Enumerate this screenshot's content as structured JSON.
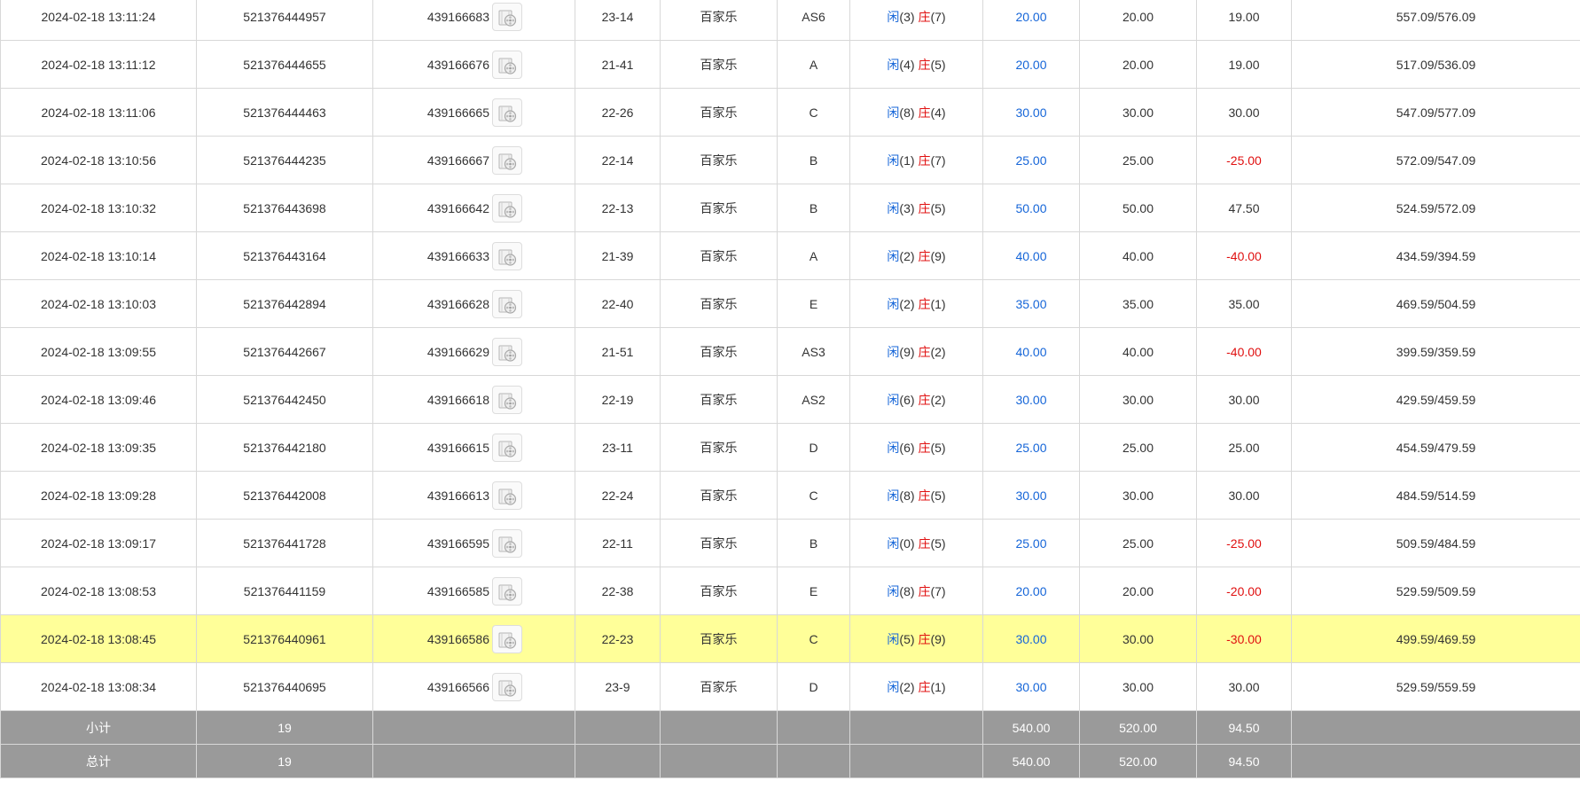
{
  "rows": [
    {
      "time": "2024-02-18 13:11:24",
      "bet_id": "521376444957",
      "round_id": "439166683",
      "table_no": "23-14",
      "game": "百家乐",
      "tbl": "AS6",
      "player_label": "闲",
      "player_pts": "(3)",
      "banker_label": "庄",
      "banker_pts": "(7)",
      "bet": "20.00",
      "valid": "20.00",
      "win": "19.00",
      "balance": "557.09/576.09"
    },
    {
      "time": "2024-02-18 13:11:12",
      "bet_id": "521376444655",
      "round_id": "439166676",
      "table_no": "21-41",
      "game": "百家乐",
      "tbl": "A",
      "player_label": "闲",
      "player_pts": "(4)",
      "banker_label": "庄",
      "banker_pts": "(5)",
      "bet": "20.00",
      "valid": "20.00",
      "win": "19.00",
      "balance": "517.09/536.09"
    },
    {
      "time": "2024-02-18 13:11:06",
      "bet_id": "521376444463",
      "round_id": "439166665",
      "table_no": "22-26",
      "game": "百家乐",
      "tbl": "C",
      "player_label": "闲",
      "player_pts": "(8)",
      "banker_label": "庄",
      "banker_pts": "(4)",
      "bet": "30.00",
      "valid": "30.00",
      "win": "30.00",
      "balance": "547.09/577.09"
    },
    {
      "time": "2024-02-18 13:10:56",
      "bet_id": "521376444235",
      "round_id": "439166667",
      "table_no": "22-14",
      "game": "百家乐",
      "tbl": "B",
      "player_label": "闲",
      "player_pts": "(1)",
      "banker_label": "庄",
      "banker_pts": "(7)",
      "bet": "25.00",
      "valid": "25.00",
      "win": "-25.00",
      "balance": "572.09/547.09"
    },
    {
      "time": "2024-02-18 13:10:32",
      "bet_id": "521376443698",
      "round_id": "439166642",
      "table_no": "22-13",
      "game": "百家乐",
      "tbl": "B",
      "player_label": "闲",
      "player_pts": "(3)",
      "banker_label": "庄",
      "banker_pts": "(5)",
      "bet": "50.00",
      "valid": "50.00",
      "win": "47.50",
      "balance": "524.59/572.09"
    },
    {
      "time": "2024-02-18 13:10:14",
      "bet_id": "521376443164",
      "round_id": "439166633",
      "table_no": "21-39",
      "game": "百家乐",
      "tbl": "A",
      "player_label": "闲",
      "player_pts": "(2)",
      "banker_label": "庄",
      "banker_pts": "(9)",
      "bet": "40.00",
      "valid": "40.00",
      "win": "-40.00",
      "balance": "434.59/394.59"
    },
    {
      "time": "2024-02-18 13:10:03",
      "bet_id": "521376442894",
      "round_id": "439166628",
      "table_no": "22-40",
      "game": "百家乐",
      "tbl": "E",
      "player_label": "闲",
      "player_pts": "(2)",
      "banker_label": "庄",
      "banker_pts": "(1)",
      "bet": "35.00",
      "valid": "35.00",
      "win": "35.00",
      "balance": "469.59/504.59"
    },
    {
      "time": "2024-02-18 13:09:55",
      "bet_id": "521376442667",
      "round_id": "439166629",
      "table_no": "21-51",
      "game": "百家乐",
      "tbl": "AS3",
      "player_label": "闲",
      "player_pts": "(9)",
      "banker_label": "庄",
      "banker_pts": "(2)",
      "bet": "40.00",
      "valid": "40.00",
      "win": "-40.00",
      "balance": "399.59/359.59"
    },
    {
      "time": "2024-02-18 13:09:46",
      "bet_id": "521376442450",
      "round_id": "439166618",
      "table_no": "22-19",
      "game": "百家乐",
      "tbl": "AS2",
      "player_label": "闲",
      "player_pts": "(6)",
      "banker_label": "庄",
      "banker_pts": "(2)",
      "bet": "30.00",
      "valid": "30.00",
      "win": "30.00",
      "balance": "429.59/459.59"
    },
    {
      "time": "2024-02-18 13:09:35",
      "bet_id": "521376442180",
      "round_id": "439166615",
      "table_no": "23-11",
      "game": "百家乐",
      "tbl": "D",
      "player_label": "闲",
      "player_pts": "(6)",
      "banker_label": "庄",
      "banker_pts": "(5)",
      "bet": "25.00",
      "valid": "25.00",
      "win": "25.00",
      "balance": "454.59/479.59"
    },
    {
      "time": "2024-02-18 13:09:28",
      "bet_id": "521376442008",
      "round_id": "439166613",
      "table_no": "22-24",
      "game": "百家乐",
      "tbl": "C",
      "player_label": "闲",
      "player_pts": "(8)",
      "banker_label": "庄",
      "banker_pts": "(5)",
      "bet": "30.00",
      "valid": "30.00",
      "win": "30.00",
      "balance": "484.59/514.59"
    },
    {
      "time": "2024-02-18 13:09:17",
      "bet_id": "521376441728",
      "round_id": "439166595",
      "table_no": "22-11",
      "game": "百家乐",
      "tbl": "B",
      "player_label": "闲",
      "player_pts": "(0)",
      "banker_label": "庄",
      "banker_pts": "(5)",
      "bet": "25.00",
      "valid": "25.00",
      "win": "-25.00",
      "balance": "509.59/484.59"
    },
    {
      "time": "2024-02-18 13:08:53",
      "bet_id": "521376441159",
      "round_id": "439166585",
      "table_no": "22-38",
      "game": "百家乐",
      "tbl": "E",
      "player_label": "闲",
      "player_pts": "(8)",
      "banker_label": "庄",
      "banker_pts": "(7)",
      "bet": "20.00",
      "valid": "20.00",
      "win": "-20.00",
      "balance": "529.59/509.59"
    },
    {
      "time": "2024-02-18 13:08:45",
      "bet_id": "521376440961",
      "round_id": "439166586",
      "table_no": "22-23",
      "game": "百家乐",
      "tbl": "C",
      "player_label": "闲",
      "player_pts": "(5)",
      "banker_label": "庄",
      "banker_pts": "(9)",
      "bet": "30.00",
      "valid": "30.00",
      "win": "-30.00",
      "balance": "499.59/469.59",
      "highlighted": true
    },
    {
      "time": "2024-02-18 13:08:34",
      "bet_id": "521376440695",
      "round_id": "439166566",
      "table_no": "23-9",
      "game": "百家乐",
      "tbl": "D",
      "player_label": "闲",
      "player_pts": "(2)",
      "banker_label": "庄",
      "banker_pts": "(1)",
      "bet": "30.00",
      "valid": "30.00",
      "win": "30.00",
      "balance": "529.59/559.59"
    }
  ],
  "subtotal": {
    "label": "小计",
    "count": "19",
    "bet": "540.00",
    "valid": "520.00",
    "win": "94.50"
  },
  "total": {
    "label": "总计",
    "count": "19",
    "bet": "540.00",
    "valid": "520.00",
    "win": "94.50"
  },
  "colors": {
    "highlight_row": "#ffff99",
    "summary_bg": "#9a9a9a",
    "blue_text": "#1565d8",
    "red_text": "#e01010"
  },
  "icons": {
    "replay": "video-reel-icon"
  }
}
